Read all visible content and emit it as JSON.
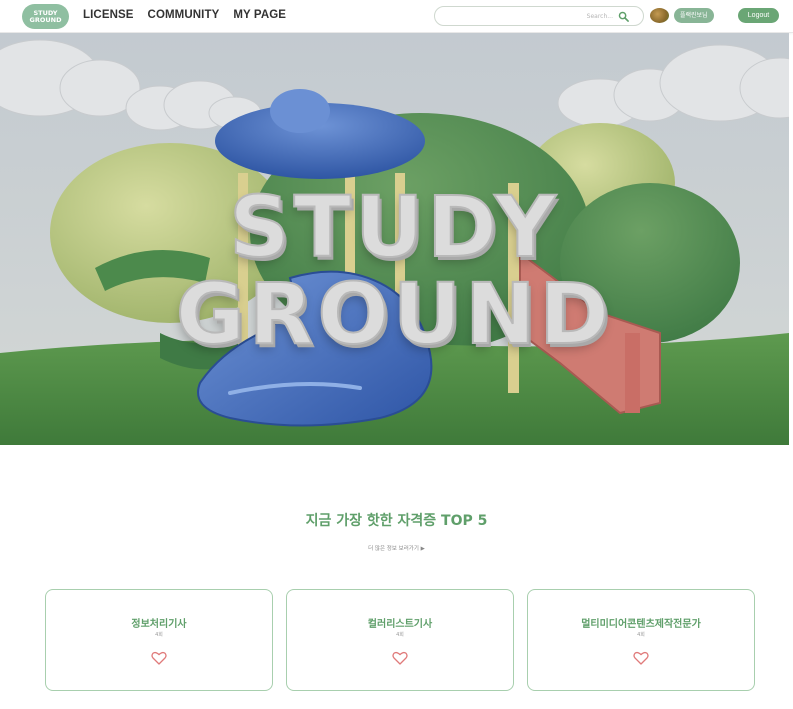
{
  "nav": {
    "logo_line1": "STUDY",
    "logo_line2": "GROUND",
    "menu": [
      {
        "label": "LICENSE"
      },
      {
        "label": "COMMUNITY"
      },
      {
        "label": "MY PAGE"
      }
    ],
    "search_placeholder": "Search...",
    "search_icon": "search-icon",
    "user_label": "플랙린보님",
    "logout_label": "Logout"
  },
  "hero": {
    "line1": "STUDY",
    "line2": "GROUND"
  },
  "section": {
    "title": "지금 가장 핫한 자격증 TOP 5",
    "more": "더 많은 정보 보러가기 ▶"
  },
  "cards": [
    {
      "name": "정보처리기사",
      "count": "4회",
      "icon": "heart-icon"
    },
    {
      "name": "컬러리스트기사",
      "count": "4회",
      "icon": "heart-icon"
    },
    {
      "name": "멀티미디어콘텐츠제작전문가",
      "count": "4회",
      "icon": "heart-icon"
    }
  ],
  "colors": {
    "accent": "#5f9f6a",
    "logo_bg": "#8fbfa1",
    "card_border": "#a8cfae"
  }
}
